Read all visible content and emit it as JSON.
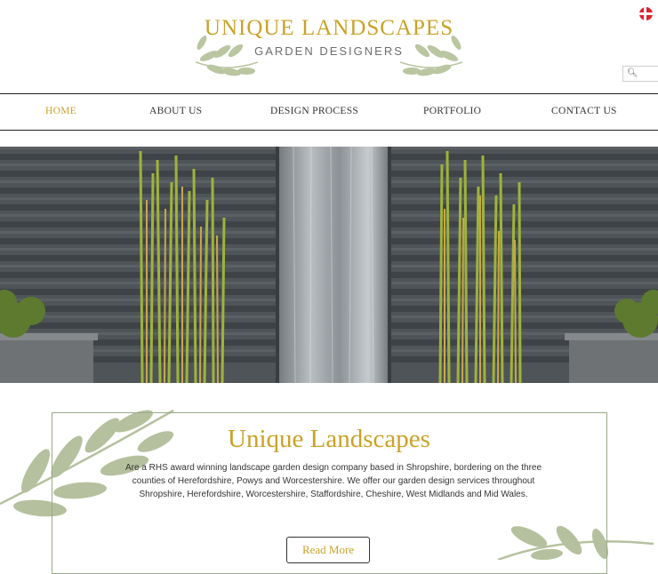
{
  "logo": {
    "title": "UNIQUE LANDSCAPES",
    "subtitle": "GARDEN DESIGNERS",
    "leaf_icon": "olive-branch-icon"
  },
  "header": {
    "language_flag": "danish-flag-icon",
    "search_icon": "search-icon",
    "search_placeholder": ""
  },
  "nav": {
    "items": [
      {
        "label": "HOME",
        "active": true
      },
      {
        "label": "ABOUT US",
        "active": false
      },
      {
        "label": "DESIGN PROCESS",
        "active": false
      },
      {
        "label": "PORTFOLIO",
        "active": false
      },
      {
        "label": "CONTACT US",
        "active": false
      }
    ]
  },
  "hero": {
    "image_subject": "garden water wall with horsetail reeds"
  },
  "content": {
    "title": "Unique Landscapes",
    "text": "Are a RHS award winning landscape garden design company based in Shropshire, bordering on the three counties of Herefordshire, Powys and Worcestershire. We offer our garden design services throughout Shropshire, Herefordshire, Worcestershire, Staffordshire, Cheshire, West Midlands and Mid Wales.",
    "button_label": "Read More"
  },
  "colors": {
    "accent_gold": "#c9a227",
    "leaf_green": "#a9b78e",
    "box_border": "#9aaa8a"
  }
}
